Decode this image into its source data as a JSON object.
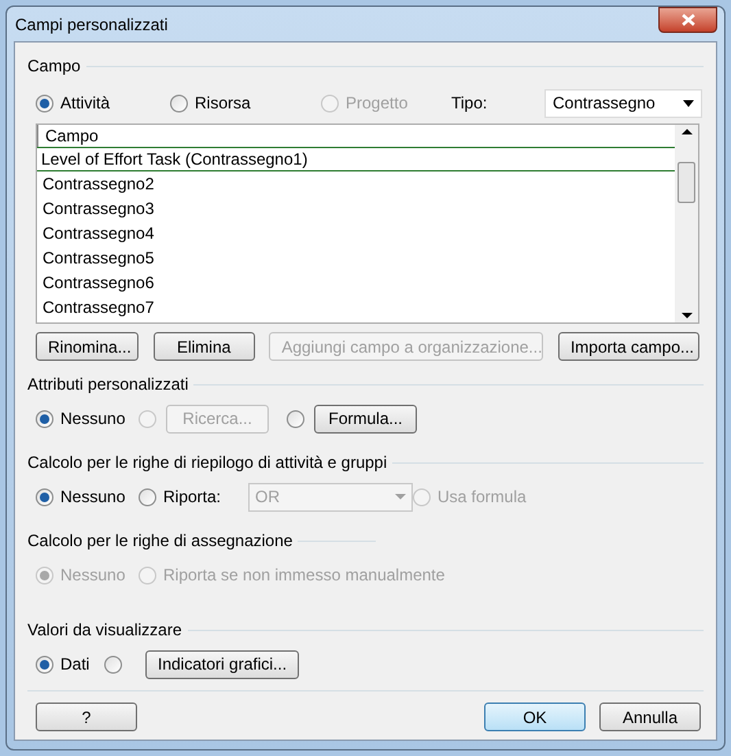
{
  "window": {
    "title": "Campi personalizzati"
  },
  "campo": {
    "legend": "Campo",
    "radios": [
      {
        "label": "Attività",
        "selected": true,
        "disabled": false
      },
      {
        "label": "Risorsa",
        "selected": false,
        "disabled": false
      },
      {
        "label": "Progetto",
        "selected": false,
        "disabled": true
      }
    ],
    "tipo_label": "Tipo:",
    "tipo_value": "Contrassegno",
    "list": {
      "header": "Campo",
      "rows": [
        {
          "label": "Level of Effort Task (Contrassegno1)",
          "selected": true
        },
        {
          "label": "Contrassegno2",
          "selected": false
        },
        {
          "label": "Contrassegno3",
          "selected": false
        },
        {
          "label": "Contrassegno4",
          "selected": false
        },
        {
          "label": "Contrassegno5",
          "selected": false
        },
        {
          "label": "Contrassegno6",
          "selected": false
        },
        {
          "label": "Contrassegno7",
          "selected": false
        }
      ]
    },
    "buttons": [
      {
        "label": "Rinomina...",
        "disabled": false
      },
      {
        "label": "Elimina",
        "disabled": false
      },
      {
        "label": "Aggiungi campo a organizzazione...",
        "disabled": true
      },
      {
        "label": "Importa campo...",
        "disabled": false
      }
    ]
  },
  "sections": [
    {
      "title": "Attributi personalizzati",
      "items": [
        {
          "kind": "radio",
          "label": "Nessuno",
          "selected": true,
          "disabled": false
        },
        {
          "kind": "radio",
          "selected": false,
          "disabled": true
        },
        {
          "kind": "button",
          "label": "Ricerca...",
          "disabled": true
        },
        {
          "kind": "radio",
          "selected": false,
          "disabled": false
        },
        {
          "kind": "button",
          "label": "Formula...",
          "disabled": false
        }
      ]
    },
    {
      "title": "Calcolo per le righe di riepilogo di attività e gruppi",
      "items": [
        {
          "kind": "radio",
          "label": "Nessuno",
          "selected": true,
          "disabled": false
        },
        {
          "kind": "radio",
          "label": "Riporta:",
          "selected": false,
          "disabled": false
        },
        {
          "kind": "dropdown",
          "value": "OR",
          "disabled": true
        },
        {
          "kind": "radio",
          "label": "Usa formula",
          "selected": false,
          "disabled": true
        }
      ]
    },
    {
      "title": "Calcolo per le righe di assegnazione",
      "items": [
        {
          "kind": "radio",
          "label": "Nessuno",
          "selected": true,
          "disabled": true
        },
        {
          "kind": "radio",
          "label": "Riporta se non immesso manualmente",
          "selected": false,
          "disabled": true
        }
      ]
    },
    {
      "title": "Valori da visualizzare",
      "items": [
        {
          "kind": "radio",
          "label": "Dati",
          "selected": true,
          "disabled": false
        },
        {
          "kind": "radio",
          "selected": false,
          "disabled": false
        },
        {
          "kind": "button",
          "label": "Indicatori grafici...",
          "disabled": false
        }
      ]
    }
  ],
  "footer": [
    {
      "label": "?",
      "default": false
    },
    {
      "label": "OK",
      "default": true
    },
    {
      "label": "Annulla",
      "default": false
    }
  ]
}
